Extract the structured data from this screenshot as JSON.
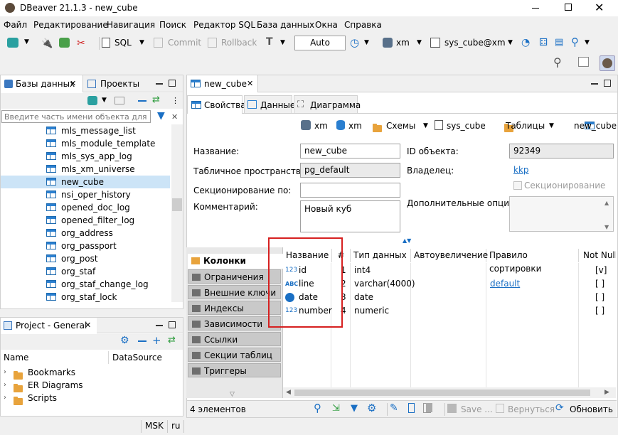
{
  "window": {
    "title": "DBeaver 21.1.3 - new_cube"
  },
  "menu": [
    "Файл",
    "Редактирование",
    "Навигация",
    "Поиск",
    "Редактор SQL",
    "База данных",
    "Окна",
    "Справка"
  ],
  "toolbar": {
    "sql": "SQL",
    "commit": "Commit",
    "rollback": "Rollback",
    "mode": "Auto",
    "connection": "xm",
    "schema": "sys_cube@xm"
  },
  "left_panel": {
    "tab_databases": "Базы данных",
    "tab_projects": "Проекты",
    "filter_placeholder": "Введите часть имени объекта для пои",
    "tree_items": [
      "mls_message_list",
      "mls_module_template",
      "mls_sys_app_log",
      "mls_xm_universe",
      "new_cube",
      "nsi_oper_history",
      "opened_doc_log",
      "opened_filter_log",
      "org_address",
      "org_passport",
      "org_post",
      "org_staf",
      "org_staf_change_log",
      "org_staf_lock"
    ],
    "selected_item": "new_cube"
  },
  "project_panel": {
    "title": "Project - General",
    "col_name": "Name",
    "col_datasource": "DataSource",
    "items": [
      "Bookmarks",
      "ER Diagrams",
      "Scripts"
    ]
  },
  "editor": {
    "tab_title": "new_cube",
    "subtabs": [
      "Свойства",
      "Данные",
      "Диаграмма"
    ],
    "breadcrumb": [
      "xm",
      "xm",
      "Схемы",
      "sys_cube",
      "Таблицы",
      "new_cube"
    ],
    "props": {
      "name_label": "Название:",
      "name_value": "new_cube",
      "tablespace_label": "Табличное пространство:",
      "tablespace_value": "pg_default",
      "partition_label": "Секционирование по:",
      "partition_value": "",
      "comment_label": "Комментарий:",
      "comment_value": "Новый куб",
      "objid_label": "ID объекта:",
      "objid_value": "92349",
      "owner_label": "Владелец:",
      "owner_value": "kkp",
      "partitioning_check": "Секционирование",
      "extra_label": "Дополнительные опции:"
    },
    "side_tabs": [
      "Колонки",
      "Ограничения",
      "Внешние ключи",
      "Индексы",
      "Зависимости",
      "Ссылки",
      "Секции таблиц",
      "Триггеры"
    ],
    "columns_header": {
      "name": "Название",
      "num": "#",
      "type": "Тип данных",
      "autoinc": "Автоувеличение",
      "sort": "Правило сортировки",
      "notnull": "Not Null"
    },
    "columns": [
      {
        "icon": "123",
        "name": "id",
        "num": "1",
        "type": "int4",
        "sort": "",
        "notnull": "[v]"
      },
      {
        "icon": "ABC",
        "name": "line",
        "num": "2",
        "type": "varchar(4000)",
        "sort": "default",
        "notnull": "[ ]"
      },
      {
        "icon": "clock",
        "name": "date",
        "num": "3",
        "type": "date",
        "sort": "",
        "notnull": "[ ]"
      },
      {
        "icon": "123",
        "name": "number",
        "num": "4",
        "type": "numeric",
        "sort": "",
        "notnull": "[ ]"
      }
    ],
    "status_count": "4 элементов",
    "save": "Save ...",
    "revert": "Вернуться",
    "refresh": "Обновить"
  },
  "statusbar": {
    "tz": "MSK",
    "lang": "ru"
  },
  "colors": {
    "highlight": "#d62020",
    "selection": "#cce4f7",
    "link": "#1a6fc4"
  }
}
